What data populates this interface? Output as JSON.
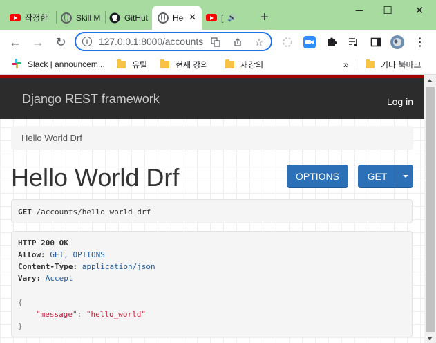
{
  "browser": {
    "tabs": [
      {
        "title": "작정한",
        "icon": "youtube-icon"
      },
      {
        "title": "Skill M",
        "icon": "globe-icon"
      },
      {
        "title": "GitHub",
        "icon": "github-icon"
      },
      {
        "title": "He",
        "icon": "globe-icon"
      },
      {
        "title": "[",
        "icon": "youtube-icon"
      }
    ],
    "new_tab": "+",
    "window": {
      "minimize": "─",
      "maximize": "☐",
      "close": "✕"
    },
    "nav": {
      "back": "←",
      "forward": "→",
      "reload": "↻"
    },
    "address": {
      "url": "127.0.0.1:8000/accounts"
    },
    "bookmarks": [
      {
        "label": "Slack | announcem...",
        "icon": "slack-icon"
      },
      {
        "label": "유틸",
        "icon": "folder-icon"
      },
      {
        "label": "현재 강의",
        "icon": "folder-icon"
      },
      {
        "label": "새강의",
        "icon": "folder-icon"
      }
    ],
    "bookmarks_overflow": "»",
    "other_bookmarks": "기타 북마크"
  },
  "page": {
    "brand": "Django REST framework",
    "login": "Log in",
    "breadcrumb": "Hello World Drf",
    "title": "Hello World Drf",
    "options_button": "OPTIONS",
    "get_button": "GET",
    "request": {
      "method": "GET",
      "path": "/accounts/hello_world_drf"
    },
    "response": {
      "status": "HTTP 200 OK",
      "allow_label": "Allow:",
      "allow_value": "GET, OPTIONS",
      "content_type_label": "Content-Type:",
      "content_type_value": "application/json",
      "vary_label": "Vary:",
      "vary_value": "Accept",
      "open_brace": "{",
      "key": "\"message\"",
      "colon": ": ",
      "value": "\"hello_world\"",
      "close_brace": "}"
    }
  },
  "colors": {
    "accent": "#2c70b7",
    "navbar": "#2c2c2c",
    "navbar_border": "#a30000",
    "chrome_frame": "#a8dba0"
  }
}
